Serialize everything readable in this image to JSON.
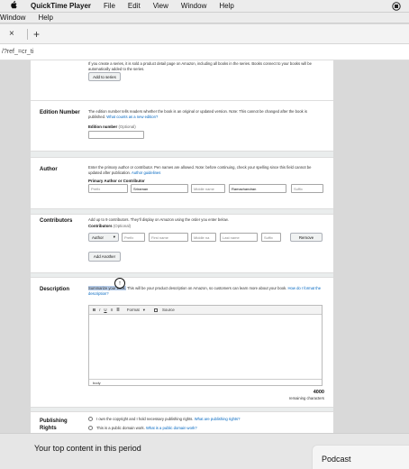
{
  "menubar": {
    "app": "QuickTime Player",
    "items": [
      "File",
      "Edit",
      "View",
      "Window",
      "Help"
    ]
  },
  "menubar2": {
    "items": [
      "Window",
      "Help"
    ]
  },
  "tabstrip": {
    "close": "×",
    "new": "+"
  },
  "address": {
    "url": "/?ref_=cr_ti"
  },
  "series": {
    "text": "If you create a series, it is sold a product detail page on Amazon, including all books in the series. Books connect to your books will be automatically added to the series.",
    "button": "Add to series"
  },
  "edition": {
    "label": "Edition Number",
    "text": "The edition number tells readers whether the book is an original or updated version. Note: This cannot be changed after the book is published.",
    "link": "What counts as a new edition?",
    "field_label": "Edition number",
    "optional": "(Optional)"
  },
  "author": {
    "label": "Author",
    "text": "Enter the primary author or contributor. Pen names are allowed. Note: before continuing, check your spelling since this field cannot be updated after publication.",
    "link": "Author guidelines",
    "field_label": "Primary Author or Contributor",
    "placeholders": [
      "Prefix",
      "Sriraman",
      "Middle name",
      "Ramachandran",
      "Suffix"
    ]
  },
  "contributors": {
    "label": "Contributors",
    "text": "Add up to 9 contributors. They'll display on Amazon using the order you enter below.",
    "field_label": "Contributors",
    "optional": "(Optional)",
    "role": "Author",
    "placeholders": [
      "Prefix",
      "First name",
      "Middle na",
      "Last name",
      "Suffix"
    ],
    "remove": "Remove",
    "add": "Add Another"
  },
  "description": {
    "label": "Description",
    "text_highlight": "Summarize your book.",
    "text_rest": " This will be your product description on Amazon, so customers can learn more about your book.",
    "link": "How do I format the description?",
    "toolbar": [
      "B",
      "I",
      "U",
      "≡",
      "≣",
      "Format",
      "▾",
      "Source"
    ],
    "footer": "body",
    "count": "4000",
    "count_label": "remaining characters"
  },
  "rights": {
    "label": "Publishing Rights",
    "opt1": "I own the copyright and I hold necessary publishing rights.",
    "opt1_link": "What are publishing rights?",
    "opt2": "This is a public domain work.",
    "opt2_link": "What is a public domain work?"
  },
  "bottom": {
    "title": "Your top content in this period",
    "card": "Podcast"
  }
}
